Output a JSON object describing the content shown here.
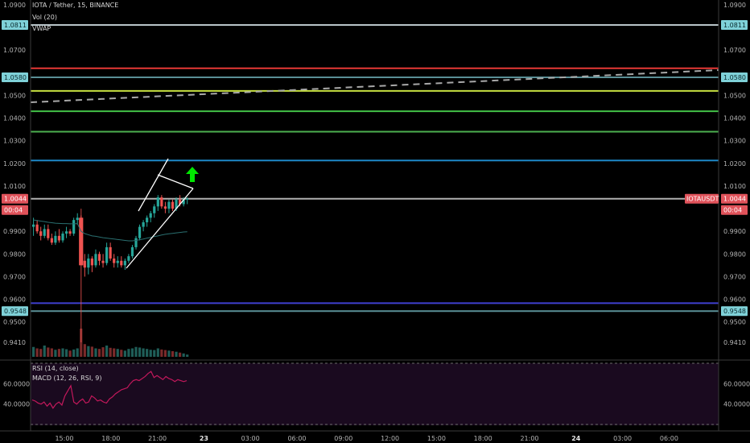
{
  "header": {
    "symbol_line": "IOTA / Tether, 15, BINANCE",
    "volume_label": "Vol (20)",
    "vwap_label": "VWAP"
  },
  "rsi_panel": {
    "label": "RSI (14, close)",
    "macd_label": "MACD (12, 26, RSI, 9)"
  },
  "colors": {
    "background": "#000000",
    "up": "#26a69a",
    "down": "#ef5350",
    "rsi_line": "#c2185b",
    "rsi_bg": "#1a0a1f",
    "vwap": "#2a6f70",
    "white_line": "#ffffff",
    "green_arrow": "#00e600",
    "price_tag_red": "#e0525a",
    "level_tag": "#7fd1d8"
  },
  "price_axis": {
    "left_ticks": [
      "1.0900",
      "1.0811",
      "1.0700",
      "1.0580",
      "1.0500",
      "1.0400",
      "1.0300",
      "1.0200",
      "1.0100",
      "1.0044",
      "00:04",
      "0.9900",
      "0.9800",
      "0.9700",
      "0.9600",
      "0.9548",
      "0.9500",
      "0.9410"
    ],
    "right_ticks": [
      "1.0900",
      "1.0811",
      "1.0700",
      "1.0580",
      "1.0500",
      "1.0400",
      "1.0300",
      "1.0200",
      "1.0100",
      "1.0044",
      "00:04",
      "0.9900",
      "0.9800",
      "0.9700",
      "0.9600",
      "0.9548",
      "0.9500",
      "0.9410"
    ],
    "current_price_label": "1.0044",
    "countdown_label": "00:04",
    "ticker_label": "IOTAUSDT"
  },
  "rsi_axis": {
    "ticks": [
      "60.0000",
      "40.0000"
    ]
  },
  "time_axis": {
    "labels": [
      "15:00",
      "18:00",
      "21:00",
      "23",
      "03:00",
      "06:00",
      "09:00",
      "12:00",
      "15:00",
      "18:00",
      "21:00",
      "24",
      "03:00",
      "06:00"
    ]
  },
  "horizontal_levels": [
    {
      "price": 1.0811,
      "color": "#b8c4c8",
      "tagged": true
    },
    {
      "price": 1.062,
      "color": "#e53935",
      "tagged": false
    },
    {
      "price": 1.058,
      "color": "#5a8f96",
      "tagged": true
    },
    {
      "price": 1.052,
      "color": "#c6e040",
      "tagged": false
    },
    {
      "price": 1.043,
      "color": "#43c047",
      "tagged": false
    },
    {
      "price": 1.034,
      "color": "#4caf50",
      "tagged": false
    },
    {
      "price": 1.0213,
      "color": "#1e88c8",
      "tagged": false
    },
    {
      "price": 1.0044,
      "color": "#b0b0b0",
      "tagged": false
    },
    {
      "price": 0.9583,
      "color": "#3f3fd0",
      "tagged": false
    },
    {
      "price": 0.9548,
      "color": "#5a8f96",
      "tagged": true
    }
  ],
  "chart_data": {
    "type": "candlestick",
    "title": "IOTA / Tether, 15, BINANCE",
    "ylim": [
      0.937,
      1.091
    ],
    "candles": [
      {
        "o": 0.992,
        "h": 0.996,
        "l": 0.988,
        "c": 0.993
      },
      {
        "o": 0.993,
        "h": 0.995,
        "l": 0.989,
        "c": 0.99
      },
      {
        "o": 0.99,
        "h": 0.992,
        "l": 0.986,
        "c": 0.988
      },
      {
        "o": 0.988,
        "h": 0.993,
        "l": 0.987,
        "c": 0.991
      },
      {
        "o": 0.991,
        "h": 0.993,
        "l": 0.986,
        "c": 0.987
      },
      {
        "o": 0.987,
        "h": 0.989,
        "l": 0.984,
        "c": 0.985
      },
      {
        "o": 0.985,
        "h": 0.99,
        "l": 0.984,
        "c": 0.988
      },
      {
        "o": 0.988,
        "h": 0.991,
        "l": 0.985,
        "c": 0.986
      },
      {
        "o": 0.986,
        "h": 0.99,
        "l": 0.985,
        "c": 0.989
      },
      {
        "o": 0.989,
        "h": 0.992,
        "l": 0.987,
        "c": 0.99
      },
      {
        "o": 0.99,
        "h": 0.991,
        "l": 0.988,
        "c": 0.989
      },
      {
        "o": 0.989,
        "h": 0.996,
        "l": 0.988,
        "c": 0.995
      },
      {
        "o": 0.995,
        "h": 0.998,
        "l": 0.993,
        "c": 0.996
      },
      {
        "o": 0.996,
        "h": 0.997,
        "l": 0.976,
        "c": 0.977
      },
      {
        "o": 0.977,
        "h": 0.98,
        "l": 0.97,
        "c": 0.974
      },
      {
        "o": 0.974,
        "h": 0.98,
        "l": 0.971,
        "c": 0.978
      },
      {
        "o": 0.978,
        "h": 0.979,
        "l": 0.972,
        "c": 0.975
      },
      {
        "o": 0.975,
        "h": 0.982,
        "l": 0.974,
        "c": 0.98
      },
      {
        "o": 0.98,
        "h": 0.981,
        "l": 0.975,
        "c": 0.977
      },
      {
        "o": 0.977,
        "h": 0.98,
        "l": 0.974,
        "c": 0.976
      },
      {
        "o": 0.976,
        "h": 0.985,
        "l": 0.975,
        "c": 0.983
      },
      {
        "o": 0.983,
        "h": 0.985,
        "l": 0.977,
        "c": 0.978
      },
      {
        "o": 0.978,
        "h": 0.98,
        "l": 0.974,
        "c": 0.976
      },
      {
        "o": 0.976,
        "h": 0.979,
        "l": 0.974,
        "c": 0.977
      },
      {
        "o": 0.977,
        "h": 0.979,
        "l": 0.974,
        "c": 0.975
      },
      {
        "o": 0.975,
        "h": 0.978,
        "l": 0.973,
        "c": 0.977
      },
      {
        "o": 0.977,
        "h": 0.98,
        "l": 0.976,
        "c": 0.979
      },
      {
        "o": 0.979,
        "h": 0.984,
        "l": 0.978,
        "c": 0.983
      },
      {
        "o": 0.983,
        "h": 0.988,
        "l": 0.982,
        "c": 0.987
      },
      {
        "o": 0.987,
        "h": 0.993,
        "l": 0.986,
        "c": 0.992
      },
      {
        "o": 0.992,
        "h": 0.995,
        "l": 0.99,
        "c": 0.994
      },
      {
        "o": 0.994,
        "h": 0.997,
        "l": 0.992,
        "c": 0.996
      },
      {
        "o": 0.996,
        "h": 0.999,
        "l": 0.994,
        "c": 0.998
      },
      {
        "o": 0.998,
        "h": 1.002,
        "l": 0.996,
        "c": 1.001
      },
      {
        "o": 1.001,
        "h": 1.006,
        "l": 0.999,
        "c": 1.005
      },
      {
        "o": 1.005,
        "h": 1.006,
        "l": 1.0,
        "c": 1.001
      },
      {
        "o": 1.001,
        "h": 1.003,
        "l": 0.998,
        "c": 1.0
      },
      {
        "o": 1.0,
        "h": 1.004,
        "l": 0.998,
        "c": 1.003
      },
      {
        "o": 1.003,
        "h": 1.004,
        "l": 0.999,
        "c": 1.0
      },
      {
        "o": 1.0,
        "h": 1.005,
        "l": 0.999,
        "c": 1.004
      },
      {
        "o": 1.004,
        "h": 1.006,
        "l": 1.001,
        "c": 1.002
      },
      {
        "o": 1.002,
        "h": 1.005,
        "l": 1.001,
        "c": 1.004
      },
      {
        "o": 1.004,
        "h": 1.005,
        "l": 1.002,
        "c": 1.0044
      }
    ],
    "big_bar": {
      "index": 13,
      "o": 0.997,
      "h": 1.0,
      "l": 0.941,
      "c": 0.977
    },
    "volume": [
      0.35,
      0.3,
      0.28,
      0.4,
      0.33,
      0.3,
      0.25,
      0.28,
      0.3,
      0.27,
      0.22,
      0.26,
      0.3,
      1.0,
      0.45,
      0.38,
      0.36,
      0.3,
      0.28,
      0.34,
      0.4,
      0.32,
      0.3,
      0.28,
      0.25,
      0.22,
      0.28,
      0.3,
      0.35,
      0.33,
      0.3,
      0.28,
      0.25,
      0.24,
      0.3,
      0.26,
      0.24,
      0.22,
      0.2,
      0.18,
      0.15,
      0.12,
      0.08
    ],
    "vwap": [
      0.995,
      0.9948,
      0.9945,
      0.9943,
      0.994,
      0.9938,
      0.9936,
      0.9935,
      0.9934,
      0.9934,
      0.9933,
      0.9933,
      0.9934,
      0.99,
      0.989,
      0.9885,
      0.988,
      0.9878,
      0.9875,
      0.9872,
      0.987,
      0.9868,
      0.9866,
      0.9864,
      0.9862,
      0.986,
      0.9858,
      0.9858,
      0.986,
      0.9863,
      0.9866,
      0.987,
      0.9873,
      0.9877,
      0.988,
      0.9884,
      0.9887,
      0.9889,
      0.9891,
      0.9893,
      0.9895,
      0.9897,
      0.9898
    ],
    "rsi": [
      44,
      43,
      41,
      40,
      42,
      38,
      41,
      36,
      40,
      42,
      39,
      48,
      53,
      58,
      42,
      40,
      43,
      45,
      41,
      42,
      48,
      46,
      43,
      44,
      42,
      41,
      45,
      47,
      50,
      52,
      54,
      55,
      56,
      60,
      63,
      64,
      63,
      65,
      67,
      70,
      72,
      66,
      68,
      66,
      64,
      67,
      65,
      64,
      62,
      64,
      63,
      62,
      63
    ]
  }
}
